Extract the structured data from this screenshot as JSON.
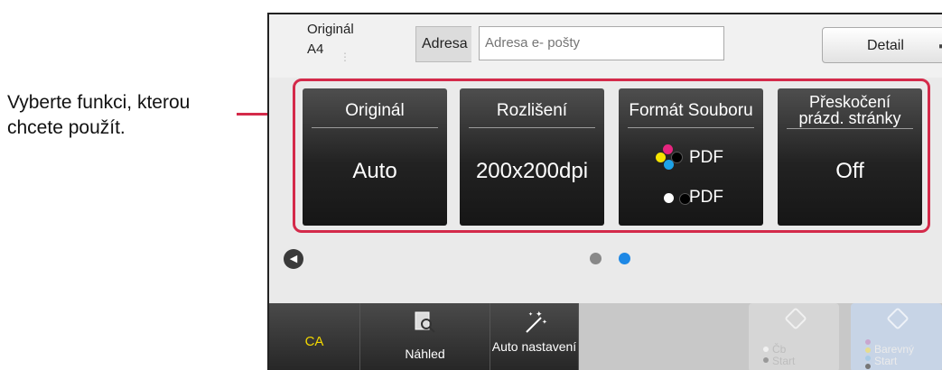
{
  "callout": {
    "text": "Vyberte funkci, kterou chcete použít."
  },
  "header": {
    "original_label": "Originál",
    "original_size": "A4",
    "address_label": "Adresa",
    "address_placeholder": "Adresa e- pošty",
    "detail_label": "Detail"
  },
  "functions": [
    {
      "title": "Originál",
      "value": "Auto"
    },
    {
      "title": "Rozlišení",
      "value": "200x200dpi"
    },
    {
      "title": "Formát Souboru",
      "color_format": "PDF",
      "bw_format": "PDF"
    },
    {
      "title": "Přeskočení prázd. stránky",
      "value": "Off"
    }
  ],
  "pager": {
    "pages": 2,
    "current": 2
  },
  "bottom": {
    "ca_label": "CA",
    "preview_label": "Náhled",
    "auto_label": "Auto nastavení",
    "bw_start_label_1": "Čb",
    "bw_start_label_2": "Start",
    "color_start_label_1": "Barevný",
    "color_start_label_2": "Start"
  },
  "colors": {
    "highlight": "#d42a4a",
    "ca_text": "#f3d800",
    "page_dot_active": "#1e88e5",
    "page_dot_inactive": "#888888"
  }
}
